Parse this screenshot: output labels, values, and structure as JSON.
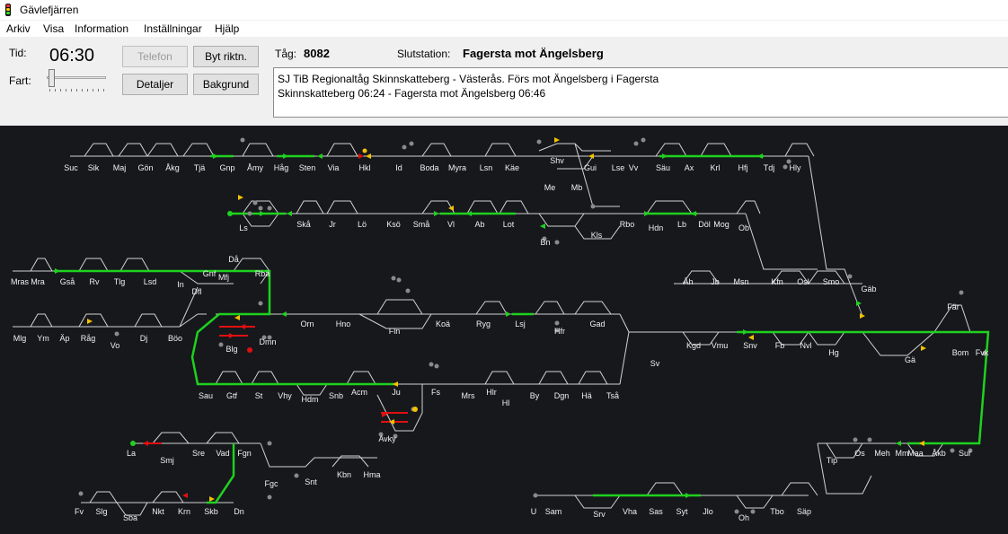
{
  "window": {
    "title": "Gävlefjärren"
  },
  "menu": [
    "Arkiv",
    "Visa",
    "Information",
    "Inställningar",
    "Hjälp"
  ],
  "controls": {
    "time_label": "Tid:",
    "time": "06:30",
    "speed_label": "Fart:",
    "phone_button": "Telefon",
    "reverse_button": "Byt riktn.",
    "details_button": "Detaljer",
    "background_button": "Bakgrund"
  },
  "train": {
    "number_label": "Tåg:",
    "number": "8082",
    "destination_label": "Slutstation:",
    "destination": "Fagersta mot Ängelsberg",
    "info_line1": "SJ TiB Regionaltåg Skinnskatteberg - Västerås. Förs mot Ängelsberg i Fagersta",
    "info_line2": "Skinnskatteberg 06:24 - Fagersta mot Ängelsberg 06:46"
  },
  "colors": {
    "map_background": "#16181c",
    "track": "#d2d2d2",
    "occupied_track": "#1fd11f",
    "reserved_track": "#e01010",
    "signal_yellow": "#f2c200"
  },
  "stations": [
    {
      "name": "Suc"
    },
    {
      "name": "Sik"
    },
    {
      "name": "Maj"
    },
    {
      "name": "Gön"
    },
    {
      "name": "Åkg"
    },
    {
      "name": "Tjä"
    },
    {
      "name": "Gnp"
    },
    {
      "name": "Åmy"
    },
    {
      "name": "Håg"
    },
    {
      "name": "Sten"
    },
    {
      "name": "Via"
    },
    {
      "name": "Hkl"
    },
    {
      "name": "Id"
    },
    {
      "name": "Boda"
    },
    {
      "name": "Myra"
    },
    {
      "name": "Lsn"
    },
    {
      "name": "Käe"
    },
    {
      "name": "Shv"
    },
    {
      "name": "Gui"
    },
    {
      "name": "Lse"
    },
    {
      "name": "Vv"
    },
    {
      "name": "Säu"
    },
    {
      "name": "Ax"
    },
    {
      "name": "Krl"
    },
    {
      "name": "Hfj"
    },
    {
      "name": "Tdj"
    },
    {
      "name": "Hly"
    },
    {
      "name": "Me"
    },
    {
      "name": "Mb"
    },
    {
      "name": "Ls"
    },
    {
      "name": "Skå"
    },
    {
      "name": "Jr"
    },
    {
      "name": "Lö"
    },
    {
      "name": "Ksö"
    },
    {
      "name": "Små"
    },
    {
      "name": "Vl"
    },
    {
      "name": "Ab"
    },
    {
      "name": "Lot"
    },
    {
      "name": "Bn"
    },
    {
      "name": "Kls"
    },
    {
      "name": "Rbo"
    },
    {
      "name": "Hdn"
    },
    {
      "name": "Lb"
    },
    {
      "name": "Döl"
    },
    {
      "name": "Mog"
    },
    {
      "name": "Ob"
    },
    {
      "name": "Då"
    },
    {
      "name": "Mras"
    },
    {
      "name": "Mra"
    },
    {
      "name": "Gså"
    },
    {
      "name": "Rv"
    },
    {
      "name": "Tlg"
    },
    {
      "name": "Lsd"
    },
    {
      "name": "In"
    },
    {
      "name": "Gnf"
    },
    {
      "name": "Mfj"
    },
    {
      "name": "Rbä"
    },
    {
      "name": "Dfl"
    },
    {
      "name": "Åh"
    },
    {
      "name": "Jb"
    },
    {
      "name": "Msn"
    },
    {
      "name": "Kfn"
    },
    {
      "name": "Osl"
    },
    {
      "name": "Smo"
    },
    {
      "name": "Gäb"
    },
    {
      "name": "Fär"
    },
    {
      "name": "Mlg"
    },
    {
      "name": "Ym"
    },
    {
      "name": "Äp"
    },
    {
      "name": "Råg"
    },
    {
      "name": "Vo"
    },
    {
      "name": "Dj"
    },
    {
      "name": "Böo"
    },
    {
      "name": "Blg"
    },
    {
      "name": "Dmn"
    },
    {
      "name": "Orn"
    },
    {
      "name": "Hno"
    },
    {
      "name": "Fln"
    },
    {
      "name": "Koä"
    },
    {
      "name": "Ryg"
    },
    {
      "name": "Lsj"
    },
    {
      "name": "Hfr"
    },
    {
      "name": "Gad"
    },
    {
      "name": "Kgd"
    },
    {
      "name": "Vmu"
    },
    {
      "name": "Snv"
    },
    {
      "name": "Fb"
    },
    {
      "name": "Nvl"
    },
    {
      "name": "Hg"
    },
    {
      "name": "Sv"
    },
    {
      "name": "Gä"
    },
    {
      "name": "Bom"
    },
    {
      "name": "Fvk"
    },
    {
      "name": "Sau"
    },
    {
      "name": "Gtf"
    },
    {
      "name": "St"
    },
    {
      "name": "Vhy"
    },
    {
      "name": "Hdm"
    },
    {
      "name": "Snb"
    },
    {
      "name": "Acm"
    },
    {
      "name": "Ju"
    },
    {
      "name": "Fs"
    },
    {
      "name": "Mrs"
    },
    {
      "name": "Hlr"
    },
    {
      "name": "Hl"
    },
    {
      "name": "By"
    },
    {
      "name": "Dgn"
    },
    {
      "name": "Hä"
    },
    {
      "name": "Tså"
    },
    {
      "name": "Avky"
    },
    {
      "name": "La"
    },
    {
      "name": "Smj"
    },
    {
      "name": "Sre"
    },
    {
      "name": "Vad"
    },
    {
      "name": "Fgn"
    },
    {
      "name": "Kbn"
    },
    {
      "name": "Hma"
    },
    {
      "name": "Fgc"
    },
    {
      "name": "Snt"
    },
    {
      "name": "Tip"
    },
    {
      "name": "Os"
    },
    {
      "name": "Meh"
    },
    {
      "name": "Mm"
    },
    {
      "name": "Maa"
    },
    {
      "name": "Åkb"
    },
    {
      "name": "Sur"
    },
    {
      "name": "Fv"
    },
    {
      "name": "Slg"
    },
    {
      "name": "Sba"
    },
    {
      "name": "Nkt"
    },
    {
      "name": "Krn"
    },
    {
      "name": "Skb"
    },
    {
      "name": "Dn"
    },
    {
      "name": "U"
    },
    {
      "name": "Sam"
    },
    {
      "name": "Srv"
    },
    {
      "name": "Vha"
    },
    {
      "name": "Sas"
    },
    {
      "name": "Syt"
    },
    {
      "name": "Jlo"
    },
    {
      "name": "Oh"
    },
    {
      "name": "Tbo"
    },
    {
      "name": "Säp"
    }
  ]
}
